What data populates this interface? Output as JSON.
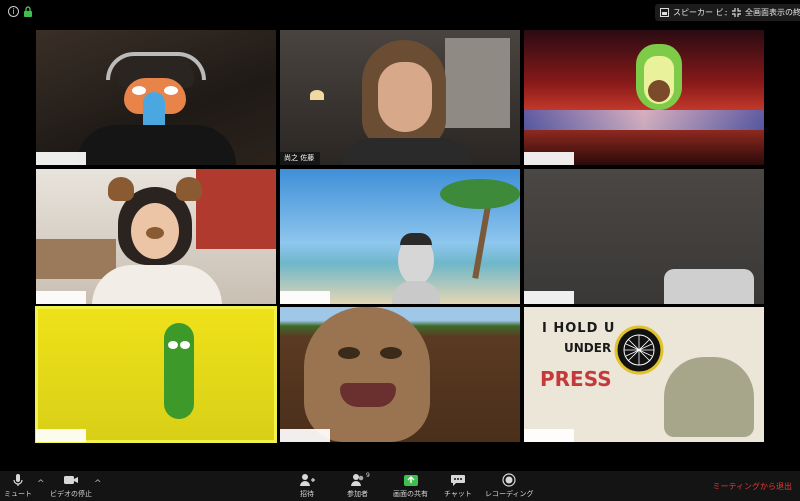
{
  "topbar": {
    "speaker_view": "スピーカー ビュー",
    "exit_fullscreen": "全画面表示の終了"
  },
  "tiles": [
    {
      "name": ""
    },
    {
      "name": "尚之 佐藤"
    },
    {
      "name": ""
    },
    {
      "name": ""
    },
    {
      "name": ""
    },
    {
      "name": ""
    },
    {
      "name": ""
    },
    {
      "name": ""
    },
    {
      "name": ""
    }
  ],
  "sign_text": {
    "line1": "I HOLD U",
    "line2": "UNDER",
    "line3": "PRESS"
  },
  "toolbar": {
    "mute": "ミュート",
    "stop_video": "ビデオの停止",
    "invite": "招待",
    "participants": "参加者",
    "participants_count": "9",
    "share": "画面の共有",
    "chat": "チャット",
    "record": "レコーディング",
    "leave": "ミーティングから退出"
  },
  "colors": {
    "active_speaker": "#f2f24a",
    "leave": "#e53935",
    "share_green": "#3fbf4f"
  }
}
